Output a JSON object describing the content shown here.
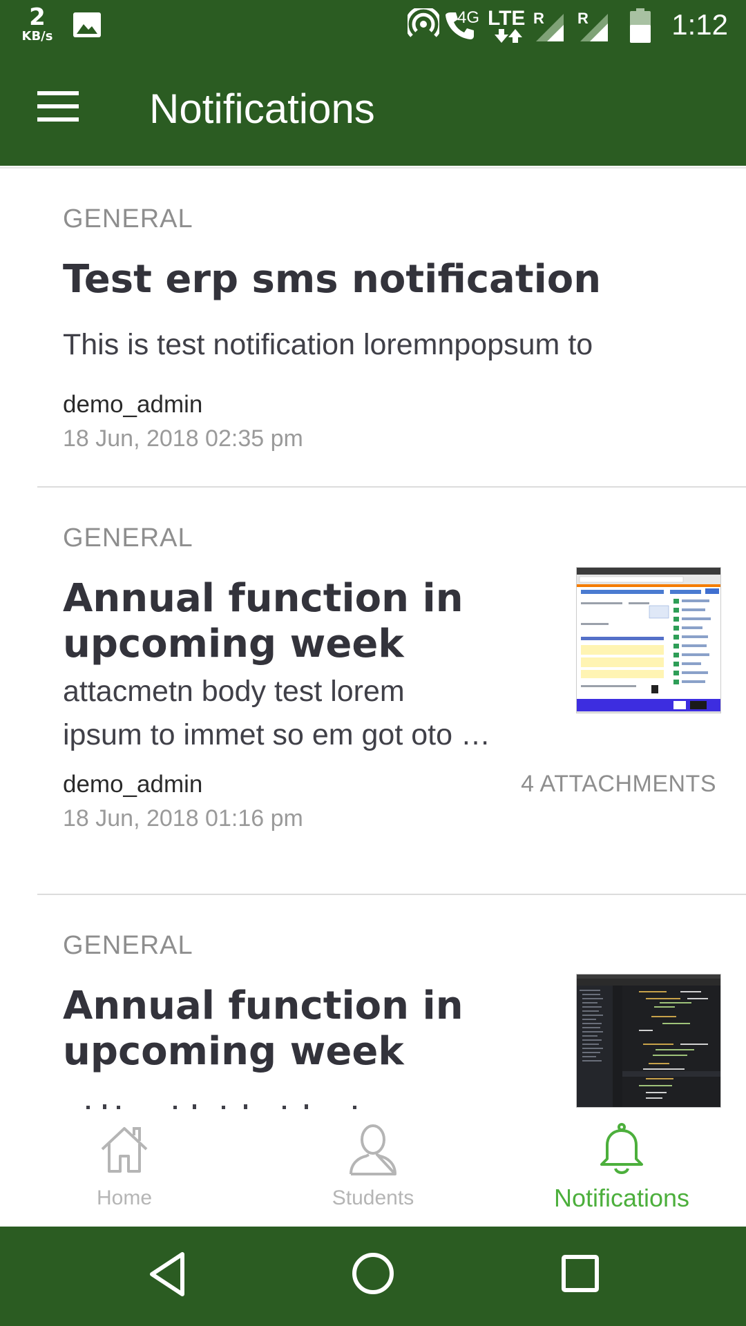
{
  "status_bar": {
    "speed_value": "2",
    "speed_unit": "KB/s",
    "network_label": "4G",
    "lte_label": "LTE",
    "roaming_1": "R",
    "roaming_2": "R",
    "time": "1:12"
  },
  "app_bar": {
    "title": "Notifications"
  },
  "notifications": [
    {
      "category": "GENERAL",
      "title": "Test erp sms notification",
      "body": "This is test notification loremnpopsum to",
      "author": "demo_admin",
      "date": "18 Jun, 2018 02:35 pm"
    },
    {
      "category": "GENERAL",
      "title_line1": "Annual function in",
      "title_line2": "upcoming week",
      "body_line1": "attacmetn body test lorem",
      "body_line2": "ipsum to immet so em got oto …",
      "author": "demo_admin",
      "date": "18 Jun, 2018 01:16 pm",
      "attachments": "4 ATTACHMENTS"
    },
    {
      "category": "GENERAL",
      "title_line1": "Annual function in",
      "title_line2": "upcoming week"
    }
  ],
  "bottom_nav": {
    "home": "Home",
    "students": "Students",
    "notifications": "Notifications",
    "active_tab": "notifications"
  },
  "colors": {
    "primary": "#2b5c22",
    "active_tab": "#4caf3c",
    "inactive_tab": "#b5b5b5"
  }
}
